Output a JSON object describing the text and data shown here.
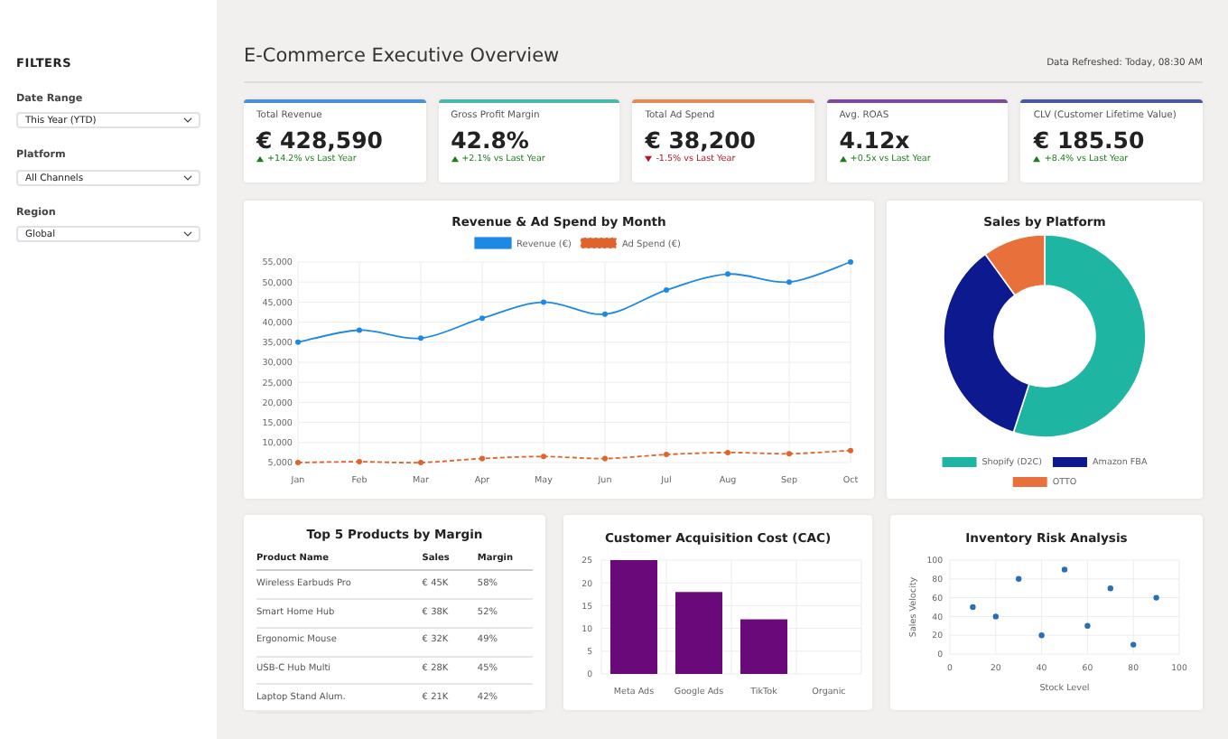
{
  "sidebar": {
    "title": "FILTERS",
    "filters": [
      {
        "label": "Date Range",
        "value": "This Year (YTD)"
      },
      {
        "label": "Platform",
        "value": "All Channels"
      },
      {
        "label": "Region",
        "value": "Global"
      }
    ]
  },
  "header": {
    "title": "E-Commerce Executive Overview",
    "refreshed": "Data Refreshed: Today, 08:30 AM"
  },
  "kpis": [
    {
      "label": "Total Revenue",
      "value": "€ 428,590",
      "change": "+14.2% vs Last Year",
      "kind": "up",
      "color": "#4a90d9"
    },
    {
      "label": "Gross Profit Margin",
      "value": "42.8%",
      "change": "+2.1% vs Last Year",
      "kind": "up",
      "color": "#4db6ac"
    },
    {
      "label": "Total Ad Spend",
      "value": "€ 38,200",
      "change": "-1.5% vs Last Year",
      "kind": "down",
      "color": "#e08a5e"
    },
    {
      "label": "Avg. ROAS",
      "value": "4.12x",
      "change": "+0.5x vs Last Year",
      "kind": "up",
      "color": "#7b4a9a"
    },
    {
      "label": "CLV (Customer Lifetime Value)",
      "value": "€ 185.50",
      "change": "+8.4% vs Last Year",
      "kind": "up",
      "color": "#4a5a9a"
    }
  ],
  "revenue_chart": {
    "chart_data": {
      "type": "line",
      "title": "Revenue & Ad Spend by Month",
      "categories": [
        "Jan",
        "Feb",
        "Mar",
        "Apr",
        "May",
        "Jun",
        "Jul",
        "Aug",
        "Sep",
        "Oct"
      ],
      "series": [
        {
          "name": "Revenue (€)",
          "color": "#1e88e5",
          "line_style": "solid",
          "marker": true,
          "values": [
            35000,
            38000,
            36000,
            41000,
            45000,
            42000,
            48000,
            52000,
            50000,
            55000
          ]
        },
        {
          "name": "Ad Spend (€)",
          "color": "#e0632b",
          "line_style": "dashed",
          "marker": true,
          "values": [
            5000,
            5200,
            5000,
            6000,
            6500,
            6000,
            7000,
            7500,
            7200,
            8000
          ]
        }
      ],
      "ylim": [
        5000,
        55000
      ],
      "grid": true,
      "legend": true,
      "yticks": [
        {
          "value": 5000,
          "label": "5,000"
        },
        {
          "value": 10000,
          "label": "10,000"
        },
        {
          "value": 15000,
          "label": "15,000"
        },
        {
          "value": 20000,
          "label": "20,000"
        },
        {
          "value": 25000,
          "label": "25,000"
        },
        {
          "value": 30000,
          "label": "30,000"
        },
        {
          "value": 35000,
          "label": "35,000"
        },
        {
          "value": 40000,
          "label": "40,000"
        },
        {
          "value": 45000,
          "label": "45,000"
        },
        {
          "value": 50000,
          "label": "50,000"
        },
        {
          "value": 55000,
          "label": "55,000"
        }
      ]
    }
  },
  "platform_chart": {
    "chart_data": {
      "type": "donut",
      "title": "Sales by Platform",
      "categories": [
        "Shopify (D2C)",
        "Amazon FBA",
        "OTTO"
      ],
      "legend": true,
      "series": [
        {
          "values": [
            55,
            35,
            10
          ],
          "colors": [
            "#1fb5a3",
            "#0d1a8f",
            "#e8703a"
          ]
        }
      ]
    }
  },
  "products_table": {
    "title": "Top 5 Products by Margin",
    "columns": [
      "Product Name",
      "Sales",
      "Margin"
    ],
    "rows": [
      [
        "Wireless Earbuds Pro",
        "€ 45K",
        "58%"
      ],
      [
        "Smart Home Hub",
        "€ 38K",
        "52%"
      ],
      [
        "Ergonomic Mouse",
        "€ 32K",
        "49%"
      ],
      [
        "USB-C Hub Multi",
        "€ 28K",
        "45%"
      ],
      [
        "Laptop Stand Alum.",
        "€ 21K",
        "42%"
      ]
    ]
  },
  "cac_chart": {
    "chart_data": {
      "type": "bar",
      "title": "Customer Acquisition Cost (CAC)",
      "categories": [
        "Meta Ads",
        "Google Ads",
        "TikTok",
        "Organic"
      ],
      "grid": true,
      "series": [
        {
          "color": "#6a0a7a",
          "values": [
            25,
            18,
            12,
            0
          ]
        }
      ],
      "ylim": [
        0,
        25
      ],
      "yticks": [
        0,
        5,
        10,
        15,
        20,
        25
      ]
    }
  },
  "inventory_chart": {
    "chart_data": {
      "type": "scatter",
      "title": "Inventory Risk Analysis",
      "xlabel": "Stock Level",
      "ylabel": "Sales Velocity",
      "grid": true,
      "x": [
        10,
        20,
        30,
        40,
        50,
        60,
        70,
        80,
        90
      ],
      "series": [
        {
          "color": "#2a6fb5",
          "values": [
            50,
            40,
            80,
            20,
            90,
            30,
            70,
            10,
            60
          ]
        }
      ],
      "xlim": [
        0,
        100
      ],
      "ylim": [
        0,
        100
      ],
      "xticks": [
        0,
        20,
        40,
        60,
        80,
        100
      ],
      "yticks": [
        0,
        20,
        40,
        60,
        80,
        100
      ]
    }
  }
}
